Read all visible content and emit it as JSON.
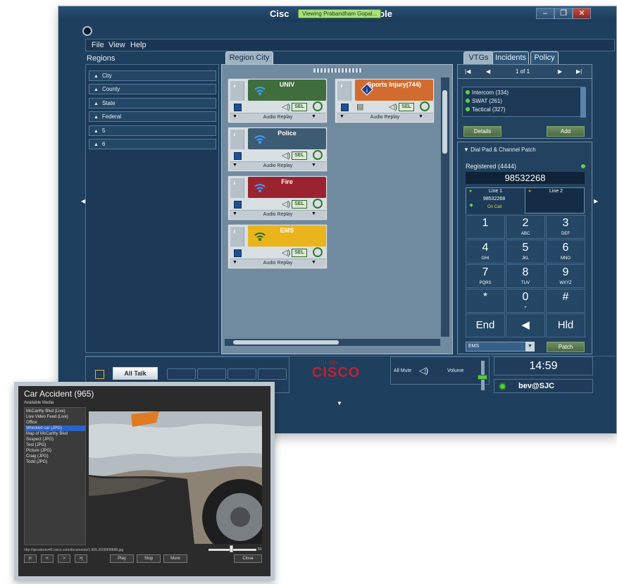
{
  "window": {
    "title_left": "Cisc",
    "title_right": "sole",
    "viewing_badge": "Viewing Prabandham Gopal..."
  },
  "menu": {
    "items": [
      "File",
      "View",
      "Help"
    ]
  },
  "regions": {
    "label": "Regions",
    "items": [
      "City",
      "County",
      "State",
      "Federal",
      "5",
      "6"
    ]
  },
  "center": {
    "tab": "Region City",
    "channels": [
      {
        "name": "UNIV",
        "color": "#3f6d3c",
        "footer": "Audio Replay",
        "sel": "SEL"
      },
      {
        "name": "Sports Injury(744)",
        "color": "#d26b2e",
        "footer": "Audio Replay",
        "sel": "SEL"
      },
      {
        "name": "Police",
        "color": "#3d5b72",
        "footer": "Audio Replay",
        "sel": "SEL"
      },
      {
        "name": "Fire",
        "color": "#9b2330",
        "footer": "Audio Replay",
        "sel": "SEL"
      },
      {
        "name": "EMS",
        "color": "#e9b41c",
        "footer": "Audio Replay",
        "sel": "SEL"
      }
    ]
  },
  "right": {
    "tabs": [
      "VTGs",
      "Incidents",
      "Policy"
    ],
    "pager": "1 of 1",
    "vtgs": [
      "Intercom (334)",
      "SWAT (261)",
      "Tactical (327)"
    ],
    "details_label": "Details",
    "add_label": "Add",
    "dial_title": "Dial Pad & Channel Patch",
    "registered": "Registered (4444)",
    "dial_number": "98532268",
    "line1": {
      "label": "Line 1",
      "number": "98532268",
      "status": "On Call"
    },
    "line2": {
      "label": "Line 2"
    },
    "keys": [
      {
        "d": "1",
        "l": ""
      },
      {
        "d": "2",
        "l": "ABC"
      },
      {
        "d": "3",
        "l": "DEF"
      },
      {
        "d": "4",
        "l": "GHI"
      },
      {
        "d": "5",
        "l": "JKL"
      },
      {
        "d": "6",
        "l": "MNO"
      },
      {
        "d": "7",
        "l": "PQRS"
      },
      {
        "d": "8",
        "l": "TUV"
      },
      {
        "d": "9",
        "l": "WXYZ"
      },
      {
        "d": "*",
        "l": ""
      },
      {
        "d": "0",
        "l": "+"
      },
      {
        "d": "#",
        "l": ""
      },
      {
        "d": "End",
        "l": ""
      },
      {
        "d": "◀",
        "l": ""
      },
      {
        "d": "Hld",
        "l": ""
      }
    ],
    "patch_select": "EMS",
    "patch_label": "Patch"
  },
  "bottom": {
    "all_talk": "All Talk",
    "cisco": "CISCO",
    "all_mute": "All Mute",
    "volume": "Volume",
    "clock": "14:59",
    "user": "bev@SJC"
  },
  "viewer": {
    "title": "Car Accident (965)",
    "available_label": "Available Media",
    "media": [
      "McCarthy Blvd (Live)",
      "Live Video Feed (Live)",
      "Office",
      "Wrecked car (JPG)",
      "Map of McCarthy Blvd",
      "Suspect (JPG)",
      "Test (JPG)",
      "Picture (JPG)",
      "Craig (JPG)",
      "Todd (JPG)"
    ],
    "selected_index": 3,
    "url": "http://ipicsdemo40.cisco.com/documents/1.965.2509908888.jpg",
    "zoom_value": "50",
    "nav_buttons": [
      "|<",
      "<",
      ">",
      ">|"
    ],
    "play_label": "Play",
    "stop_label": "Stop",
    "more_label": "More",
    "close_label": "Close"
  }
}
